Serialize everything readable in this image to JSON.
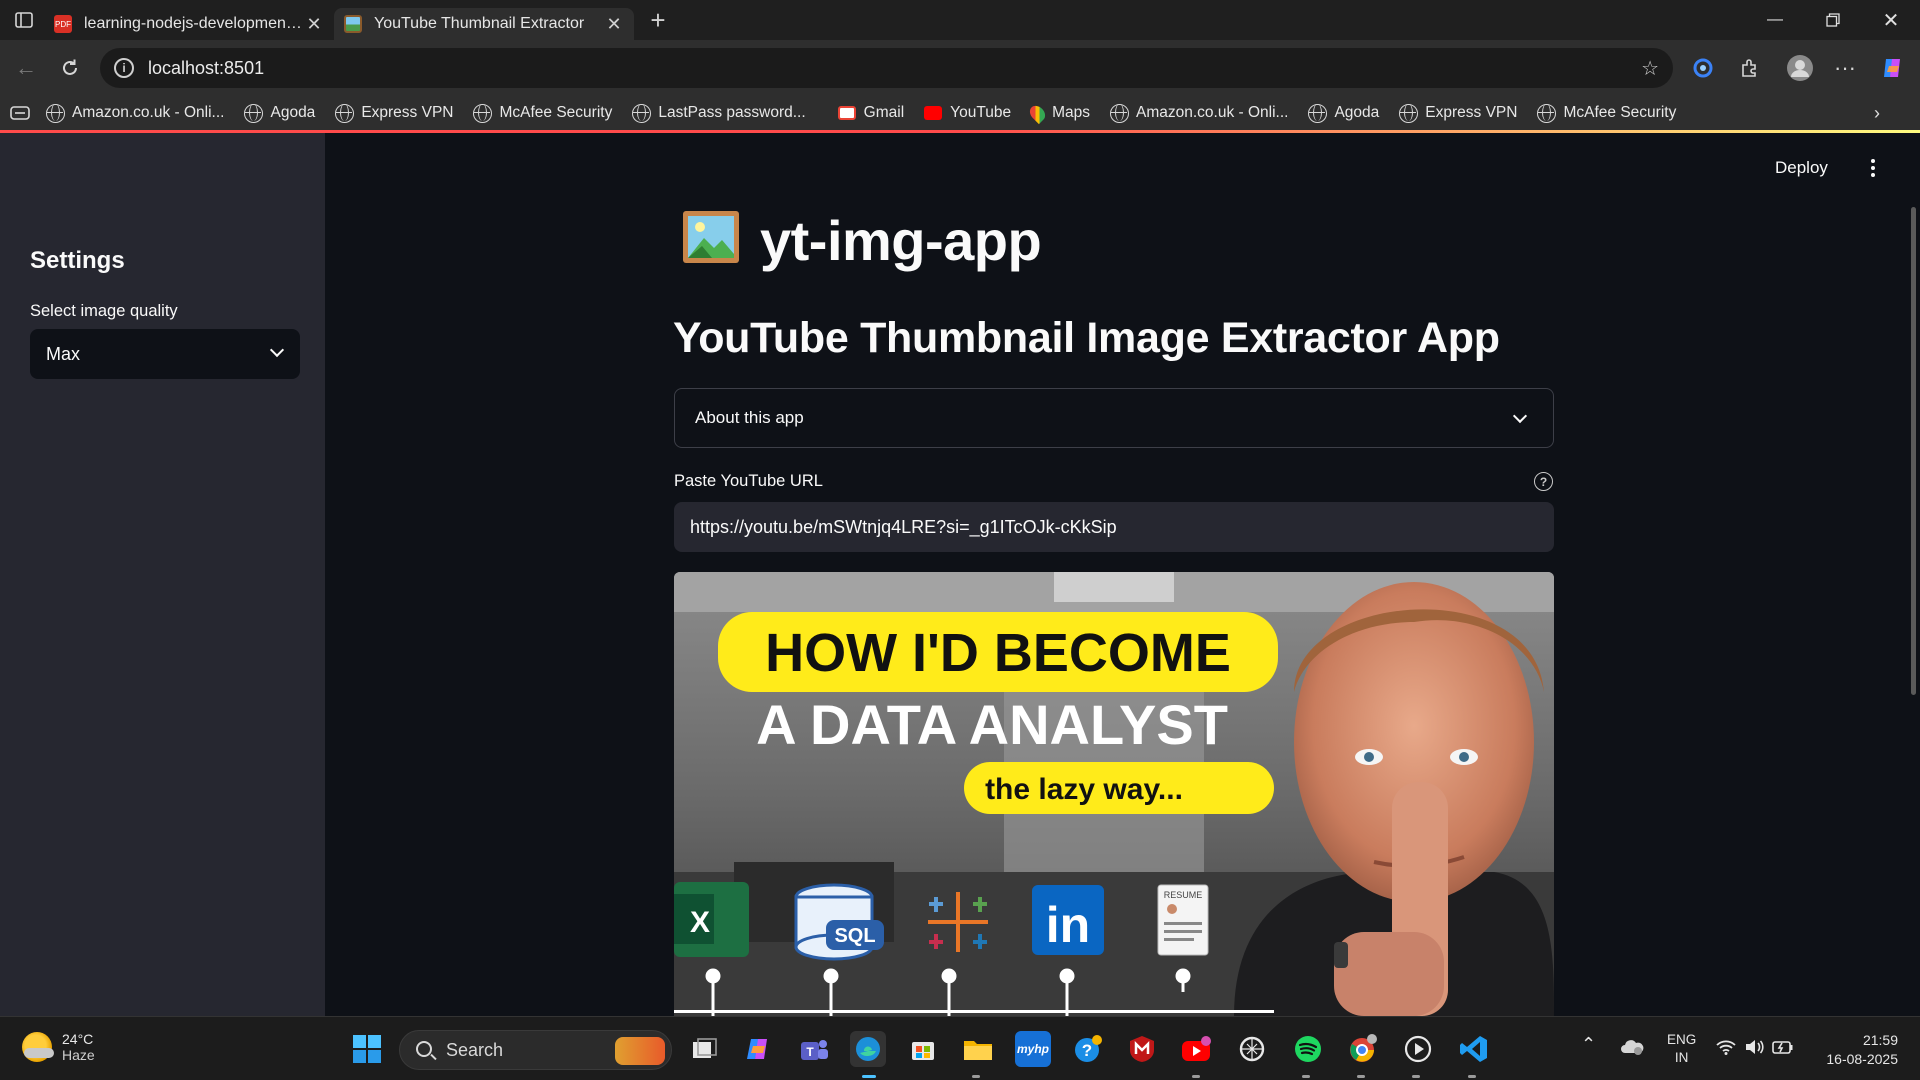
{
  "browser": {
    "tabs": [
      {
        "title": "learning-nodejs-development.pdf",
        "active": false
      },
      {
        "title": "YouTube Thumbnail Extractor",
        "active": true
      }
    ],
    "address": "localhost:8501",
    "bookmarks": [
      {
        "label": "Amazon.co.uk - Onli...",
        "icon": "globe-icon"
      },
      {
        "label": "Agoda",
        "icon": "globe-icon"
      },
      {
        "label": "Express VPN",
        "icon": "globe-icon"
      },
      {
        "label": "McAfee Security",
        "icon": "globe-icon"
      },
      {
        "label": "LastPass password...",
        "icon": "globe-icon"
      },
      {
        "label": "Gmail",
        "icon": "gmail-icon"
      },
      {
        "label": "YouTube",
        "icon": "youtube-icon"
      },
      {
        "label": "Maps",
        "icon": "maps-icon"
      },
      {
        "label": "Amazon.co.uk - Onli...",
        "icon": "globe-icon"
      },
      {
        "label": "Agoda",
        "icon": "globe-icon"
      },
      {
        "label": "Express VPN",
        "icon": "globe-icon"
      },
      {
        "label": "McAfee Security",
        "icon": "globe-icon"
      }
    ]
  },
  "app": {
    "sidebar": {
      "heading": "Settings",
      "quality_label": "Select image quality",
      "quality_value": "Max"
    },
    "deploy_label": "Deploy",
    "title": "yt-img-app",
    "subtitle": "YouTube Thumbnail Image Extractor App",
    "expander_label": "About this app",
    "url_label": "Paste YouTube URL",
    "url_value": "https://youtu.be/mSWtnjq4LRE?si=_g1ITcOJk-cKkSip",
    "thumbnail": {
      "line1": "HOW I'D BECOME",
      "line2": "A DATA ANALYST",
      "line3": "the lazy way...",
      "resume_label": "RESUME",
      "sql_label": "SQL"
    }
  },
  "taskbar": {
    "temperature": "24°C",
    "weather": "Haze",
    "search_placeholder": "Search",
    "lang_top": "ENG",
    "lang_bottom": "IN",
    "time": "21:59",
    "date": "16-08-2025"
  },
  "colors": {
    "streamlit_bg": "#0e1117",
    "sidebar_bg": "#262730",
    "accent_red": "#ff4b4b",
    "thumbnail_yellow": "#ffeb1a"
  }
}
